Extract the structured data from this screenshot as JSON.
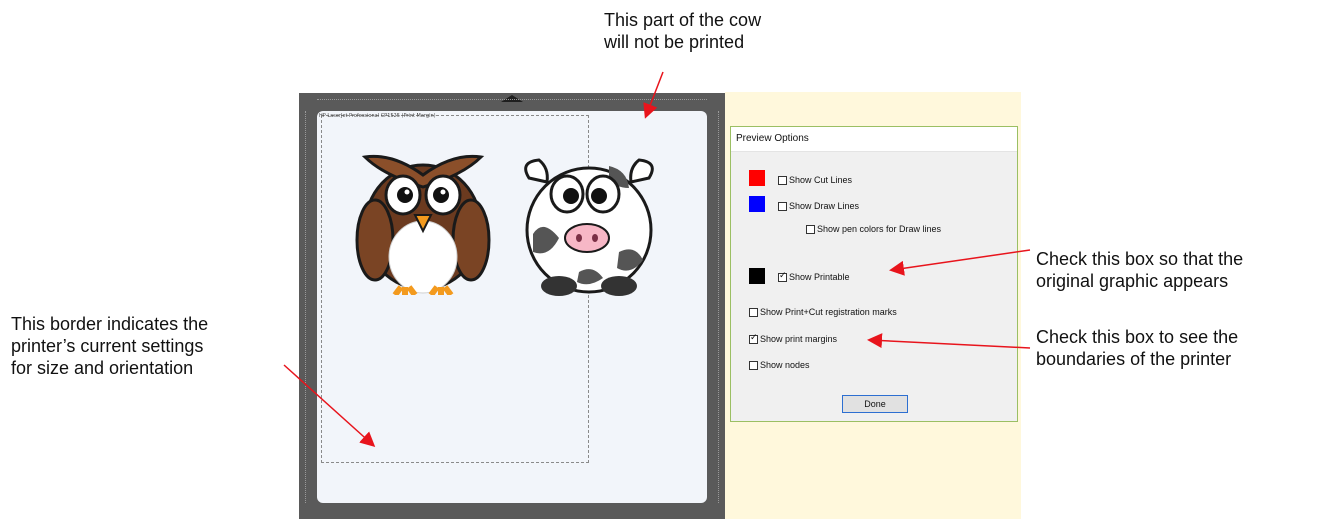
{
  "callouts": {
    "cow_not_printed": [
      "This part of the cow",
      "will not be printed"
    ],
    "border_indicates": [
      "This border indicates the",
      "printer’s current settings",
      "for size and orientation"
    ],
    "check_printable": [
      "Check this box so that the",
      "original graphic appears"
    ],
    "check_margins": [
      "Check this box to see the",
      "boundaries of the printer"
    ]
  },
  "mat": {
    "printer_label": "HP LaserJet Professional CP1525 (Print Margin)"
  },
  "dialog": {
    "title": "Preview Options",
    "options": {
      "show_cut_lines": {
        "label": "Show Cut Lines",
        "checked": false,
        "swatch_color": "#ff0000"
      },
      "show_draw_lines": {
        "label": "Show Draw Lines",
        "checked": false,
        "swatch_color": "#0000ff"
      },
      "show_pen_colors": {
        "label": "Show pen colors for Draw lines",
        "checked": false
      },
      "show_printable": {
        "label": "Show Printable",
        "checked": true,
        "swatch_color": "#000000"
      },
      "show_registration": {
        "label": "Show Print+Cut registration marks",
        "checked": false
      },
      "show_print_margins": {
        "label": "Show print margins",
        "checked": true
      },
      "show_nodes": {
        "label": "Show nodes",
        "checked": false
      }
    },
    "done_label": "Done"
  },
  "colors": {
    "arrow": "#e8141c",
    "dialog_border": "#9bbf63",
    "mat": "#5a5a5a",
    "background_panel": "#fff8dc"
  }
}
